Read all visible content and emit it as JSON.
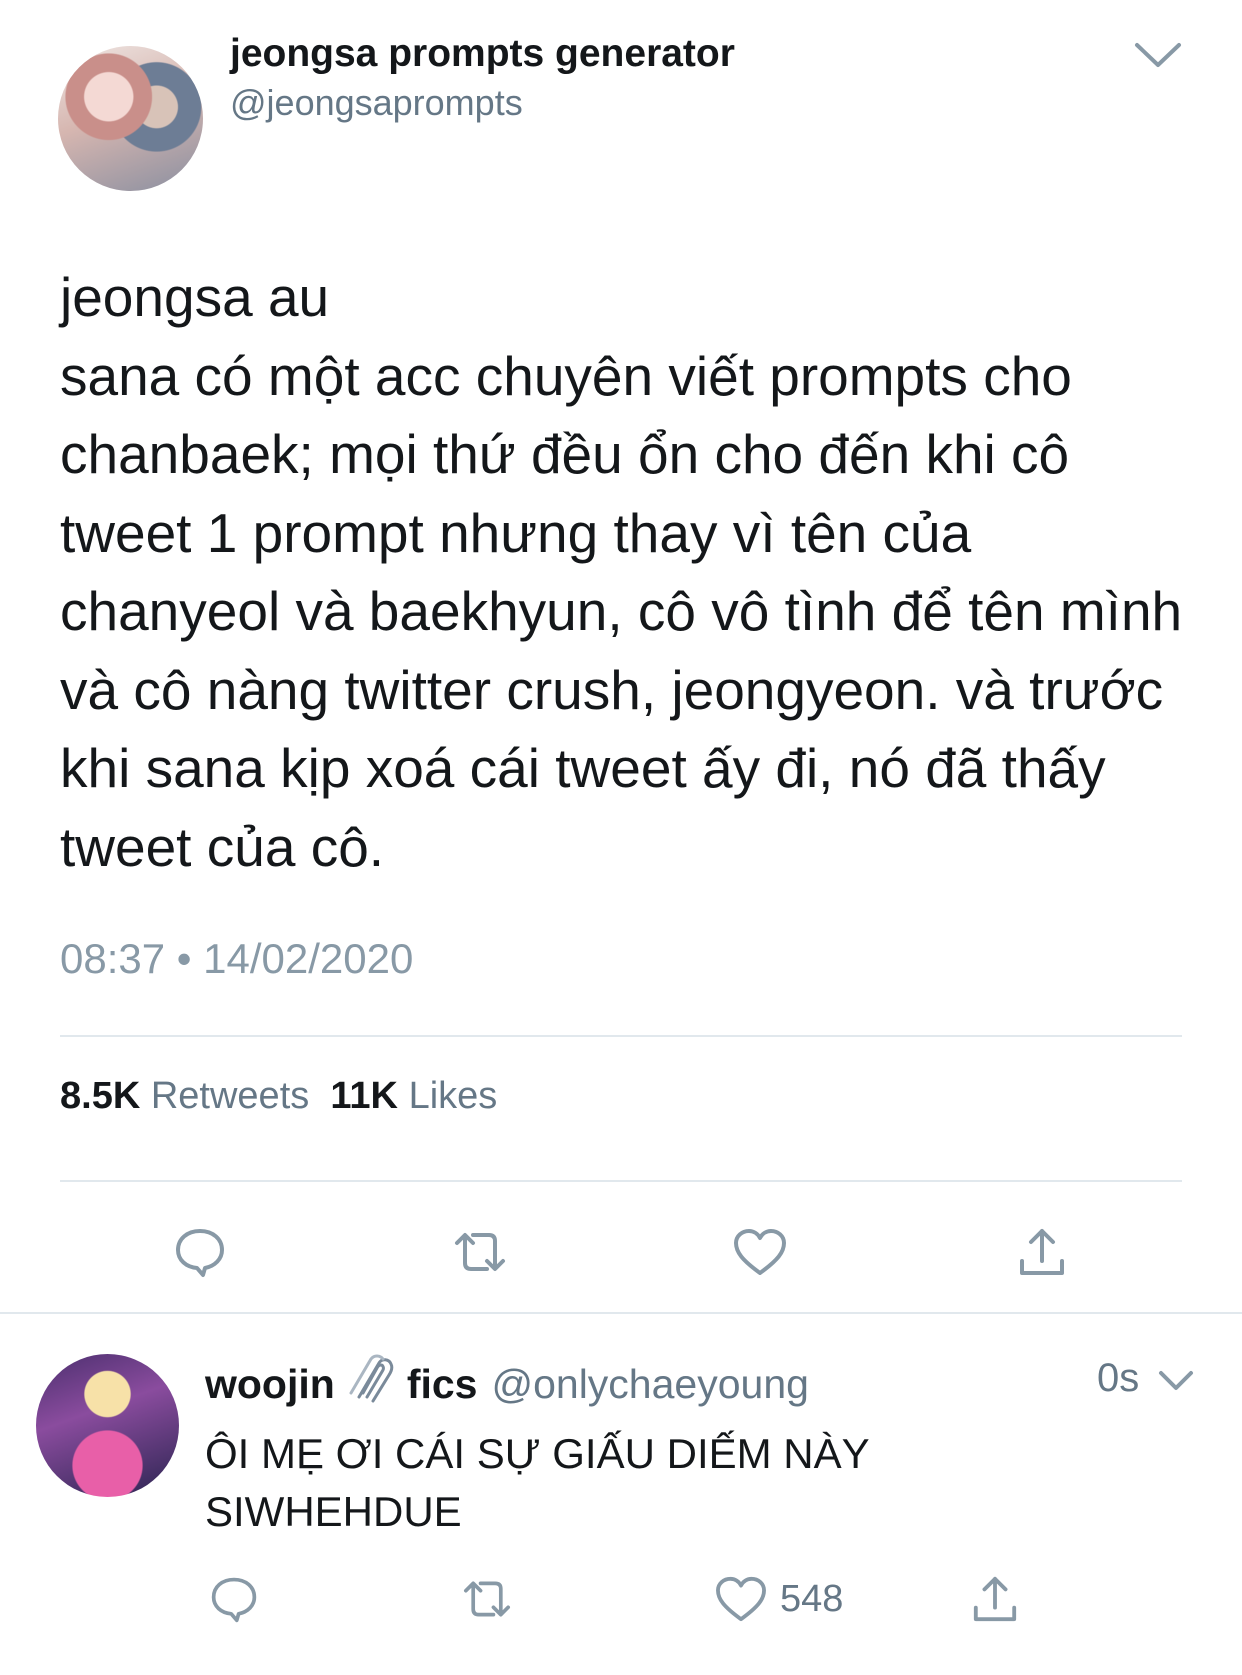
{
  "tweet": {
    "display_name": "jeongsa prompts generator",
    "handle": "@jeongsaprompts",
    "body": "jeongsa au\nsana có một acc chuyên viết prompts cho chanbaek; mọi thứ đều ổn cho đến khi cô tweet 1 prompt nhưng thay vì tên của chanyeol và baekhyun, cô vô tình để tên mình và cô nàng twitter crush, jeongyeon. và trước khi sana kịp xoá cái tweet ấy đi, nó đã thấy tweet của cô.",
    "timestamp": "08:37 • 14/02/2020",
    "retweet_count": "8.5K",
    "retweet_label": "Retweets",
    "like_count": "11K",
    "like_label": "Likes"
  },
  "reply": {
    "name_part1": "woojin",
    "name_part2": "fics",
    "handle": "@onlychaeyoung",
    "time": "0s",
    "text": "ÔI MẸ ƠI CÁI SỰ GIẤU DIẾM NÀY\nSIWHEHDUE",
    "like_count": "548"
  },
  "icons": {
    "menu": "chevron-down-icon",
    "reply": "reply-bubble-icon",
    "retweet": "retweet-icon",
    "like": "heart-icon",
    "share": "share-icon",
    "name_emoji": "paperclip-icon"
  },
  "colors": {
    "text": "#14171a",
    "secondary": "#657786",
    "icon": "#8899a6",
    "divider": "#e1e8ed"
  }
}
